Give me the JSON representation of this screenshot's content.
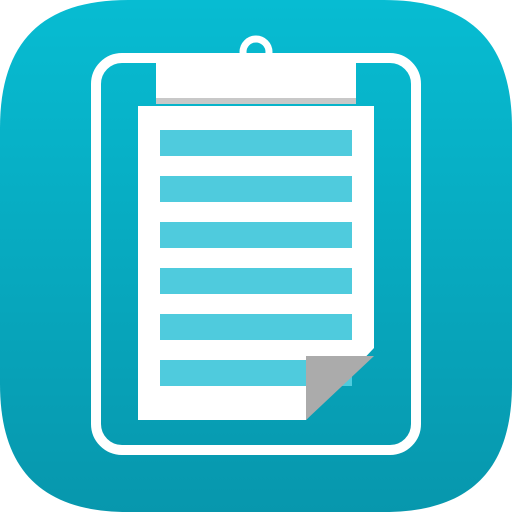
{
  "icon": {
    "name": "clipboard-notes-app-icon",
    "glyph": "clipboard-icon",
    "lines_count": 6,
    "colors": {
      "background_top": "#07BCD2",
      "background_bottom": "#0797AD",
      "board_outline": "#FFFFFF",
      "paper": "#FFFFFF",
      "lines": "#4FCBDD",
      "page_curl": "#ABABAB",
      "clip_edge": "#C8C8C8"
    }
  }
}
